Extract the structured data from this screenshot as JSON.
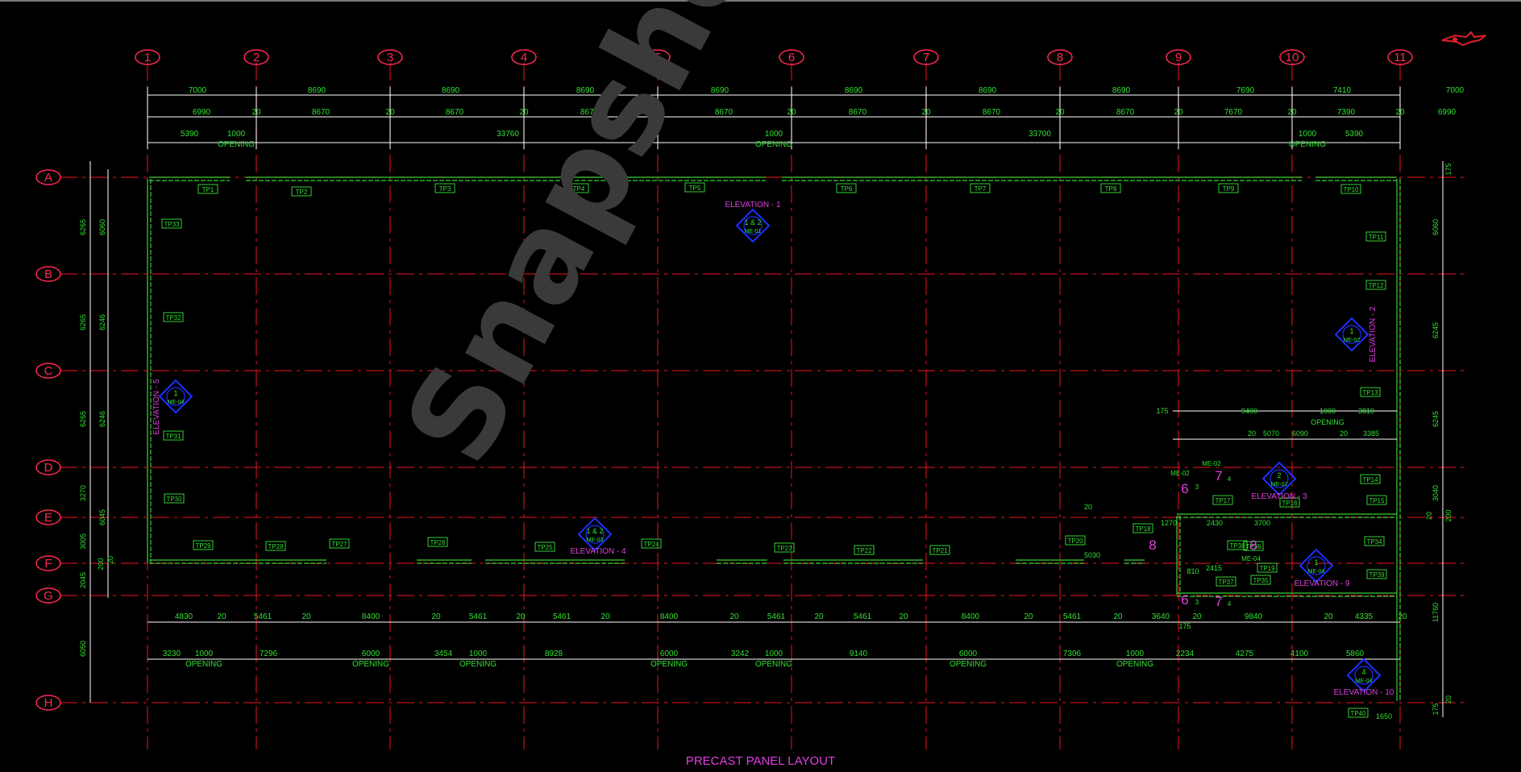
{
  "title": "PRECAST PANEL LAYOUT",
  "watermark": "Snapshot",
  "colors": {
    "background": "#000000",
    "grid_line": "#c0101a",
    "grid_bubble": "#ff2a50",
    "wall": "#35d035",
    "dimension_text": "#32e032",
    "dimension_line": "#ffffff",
    "annotation": "#e040e0",
    "marker": "#1a30ff"
  },
  "grid": {
    "columns": [
      "1",
      "2",
      "3",
      "4",
      "5",
      "6",
      "7",
      "8",
      "9",
      "10",
      "11"
    ],
    "rows": [
      "A",
      "B",
      "C",
      "D",
      "E",
      "F",
      "G",
      "H"
    ]
  },
  "dimensions": {
    "top_row1": [
      "7000",
      "8690",
      "8690",
      "8690",
      "8690",
      "8690",
      "8690",
      "8690",
      "7690",
      "7410",
      "7000"
    ],
    "top_row2": [
      "6990",
      "20",
      "8670",
      "20",
      "8670",
      "20",
      "8670",
      "20",
      "8670",
      "20",
      "8670",
      "20",
      "8670",
      "20",
      "8670",
      "20",
      "7670",
      "20",
      "7390",
      "20",
      "6990"
    ],
    "top_row3": [
      "5390",
      "1000",
      "33760",
      "1000",
      "33700",
      "1000",
      "5390"
    ],
    "top_openings": [
      "OPENING",
      "OPENING",
      "OPENING"
    ],
    "bottom_row1": [
      "4830",
      "20",
      "5461",
      "20",
      "8400",
      "20",
      "5461",
      "20",
      "5461",
      "20",
      "8400",
      "20",
      "5461",
      "20",
      "5461",
      "20",
      "8400",
      "20",
      "5461",
      "20",
      "3640",
      "20",
      "9840",
      "20",
      "4335",
      "20"
    ],
    "bottom_row2": [
      "3230",
      "1000",
      "7296",
      "6000",
      "3454",
      "1000",
      "8928",
      "6000",
      "3242",
      "1000",
      "9140",
      "6000",
      "7306",
      "1000",
      "2234",
      "4275",
      "4100",
      "5860"
    ],
    "bottom_openings": [
      "OPENING",
      "OPENING",
      "OPENING",
      "OPENING",
      "OPENING",
      "OPENING",
      "OPENING"
    ],
    "left_side": [
      "6265",
      "6060",
      "6265",
      "6246",
      "6265",
      "6246",
      "3270",
      "6045",
      "3005",
      "2045",
      "6050",
      "200",
      "20"
    ],
    "right_side": [
      "175",
      "6060",
      "6245",
      "6245",
      "3040",
      "200",
      "20",
      "11760",
      "20",
      "175"
    ],
    "right_block": [
      "175",
      "9400",
      "1000",
      "3810",
      "OPENING",
      "5070",
      "20",
      "6090",
      "20",
      "3385",
      "1270",
      "2430",
      "3700",
      "2415",
      "175",
      "810",
      "1650",
      "5030",
      "20"
    ]
  },
  "panel_tags": [
    "TP1",
    "TP2",
    "TP3",
    "TP4",
    "TP5",
    "TP6",
    "TP7",
    "TP8",
    "TP9",
    "TP10",
    "TP11",
    "TP12",
    "TP13",
    "TP14",
    "TP15",
    "TP16",
    "TP17",
    "TP18",
    "TP19",
    "TP20",
    "TP21",
    "TP22",
    "TP23",
    "TP24",
    "TP25",
    "TP26",
    "TP27",
    "TP28",
    "TP29",
    "TP30",
    "TP31",
    "TP32",
    "TP33",
    "TP34",
    "TP35",
    "TP36",
    "TP37",
    "TP38",
    "TP39",
    "TP40"
  ],
  "elevations": [
    {
      "label": "ELEVATION - 1",
      "num": "1 & 2",
      "ref": "ME-01"
    },
    {
      "label": "ELEVATION - 2",
      "num": "1",
      "ref": "ME-02"
    },
    {
      "label": "ELEVATION - 3",
      "num": "2",
      "ref": "ME-02"
    },
    {
      "label": "ELEVATION - 4",
      "num": "1 & 2",
      "ref": "ME-03"
    },
    {
      "label": "ELEVATION - 5",
      "num": "1",
      "ref": "ME-04"
    },
    {
      "label": "ELEVATION - 9",
      "num": "1",
      "ref": "ME-04"
    },
    {
      "label": "ELEVATION - 10",
      "num": "4",
      "ref": "ME-04"
    }
  ],
  "section_marks": [
    "6",
    "7",
    "8",
    "6",
    "7",
    "8"
  ],
  "section_refs": [
    "ME-02",
    "ME-02",
    "ME-04",
    "3",
    "4",
    "3",
    "4"
  ]
}
